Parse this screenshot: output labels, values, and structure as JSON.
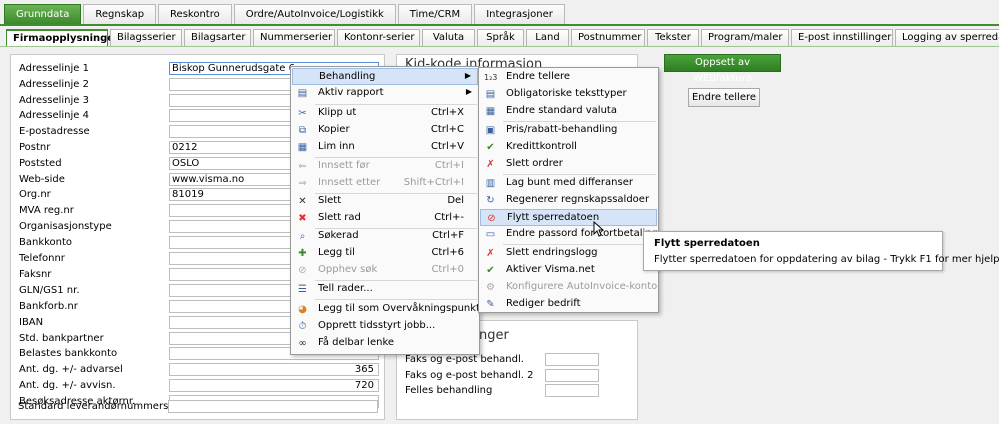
{
  "top_tabs": [
    "Grunndata",
    "Regnskap",
    "Reskontro",
    "Ordre/AutoInvoice/Logistikk",
    "Time/CRM",
    "Integrasjoner"
  ],
  "sub_tabs": [
    "Firmaopplysninger",
    "Bilagsserier",
    "Bilagsarter",
    "Nummerserier",
    "Kontonr-serier",
    "Valuta",
    "Språk",
    "Land",
    "Postnummer",
    "Tekster",
    "Program/maler",
    "E-post innstillinger",
    "Logging av sperredato"
  ],
  "form": [
    {
      "label": "Adresselinje 1",
      "value": "Biskop Gunnerudsgate 6"
    },
    {
      "label": "Adresselinje 2",
      "value": ""
    },
    {
      "label": "Adresselinje 3",
      "value": ""
    },
    {
      "label": "Adresselinje 4",
      "value": ""
    },
    {
      "label": "E-postadresse",
      "value": ""
    },
    {
      "label": "Postnr",
      "value": "0212"
    },
    {
      "label": "Poststed",
      "value": "OSLO"
    },
    {
      "label": "Web-side",
      "value": "www.visma.no"
    },
    {
      "label": "Org.nr",
      "value": "81019"
    },
    {
      "label": "MVA reg.nr",
      "value": ""
    },
    {
      "label": "Organisasjonstype",
      "value": ""
    },
    {
      "label": "Bankkonto",
      "value": ""
    },
    {
      "label": "Telefonnr",
      "value": ""
    },
    {
      "label": "Faksnr",
      "value": ""
    },
    {
      "label": "GLN/GS1 nr.",
      "value": ""
    },
    {
      "label": "Bankforb.nr",
      "value": ""
    },
    {
      "label": "IBAN",
      "value": ""
    },
    {
      "label": "Std. bankpartner",
      "value": ""
    },
    {
      "label": "Belastes bankkonto",
      "value": ""
    },
    {
      "label": "Ant. dg. +/- advarsel",
      "value": "365"
    },
    {
      "label": "Ant. dg. +/- avvisn.",
      "value": "720"
    },
    {
      "label": "Besøksadresse aktørnr.",
      "value": ""
    },
    {
      "label": "Standard leverandørnummerserie",
      "value": ""
    }
  ],
  "mid_title": "Kid-kode informasjon",
  "mid2_title_fragment": "nger",
  "mid2_rows": [
    "Faks og e-post behandl.",
    "Faks og e-post behandl. 2",
    "Felles behandling"
  ],
  "buttons": {
    "webfaktura": "Oppsett av WEBfaktura",
    "endre_tellere": "Endre tellere"
  },
  "menu1": [
    {
      "icon": "",
      "label": "Behandling",
      "shortcut": "",
      "submenu": true,
      "disabled": false
    },
    {
      "icon": "▤",
      "label": "Aktiv rapport",
      "shortcut": "",
      "submenu": true,
      "disabled": false
    },
    {
      "icon": "✂",
      "label": "Klipp ut",
      "shortcut": "Ctrl+X",
      "submenu": false,
      "disabled": false
    },
    {
      "icon": "⧉",
      "label": "Kopier",
      "shortcut": "Ctrl+C",
      "submenu": false,
      "disabled": false
    },
    {
      "icon": "📋",
      "label": "Lim inn",
      "shortcut": "Ctrl+V",
      "submenu": false,
      "disabled": false
    },
    {
      "icon": "⇐",
      "label": "Innsett før",
      "shortcut": "Ctrl+I",
      "submenu": false,
      "disabled": true
    },
    {
      "icon": "⇒",
      "label": "Innsett etter",
      "shortcut": "Shift+Ctrl+I",
      "submenu": false,
      "disabled": true
    },
    {
      "icon": "✕",
      "label": "Slett",
      "shortcut": "Del",
      "submenu": false,
      "disabled": false
    },
    {
      "icon": "✖",
      "label": "Slett rad",
      "shortcut": "Ctrl+-",
      "submenu": false,
      "disabled": false
    },
    {
      "icon": "🔍",
      "label": "Søkerad",
      "shortcut": "Ctrl+F",
      "submenu": false,
      "disabled": false
    },
    {
      "icon": "✚",
      "label": "Legg til",
      "shortcut": "Ctrl+6",
      "submenu": false,
      "disabled": false
    },
    {
      "icon": "⊘",
      "label": "Opphev søk",
      "shortcut": "Ctrl+0",
      "submenu": false,
      "disabled": true
    },
    {
      "icon": "☰",
      "label": "Tell rader...",
      "shortcut": "",
      "submenu": false,
      "disabled": false
    },
    {
      "icon": "◕",
      "label": "Legg til som Overvåkningspunkt...",
      "shortcut": "",
      "submenu": false,
      "disabled": false
    },
    {
      "icon": "⏱",
      "label": "Opprett tidsstyrt jobb...",
      "shortcut": "",
      "submenu": false,
      "disabled": false
    },
    {
      "icon": "∞",
      "label": "Få delbar lenke",
      "shortcut": "",
      "submenu": false,
      "disabled": false
    }
  ],
  "menu2": [
    {
      "icon": "1₂3",
      "label": "Endre tellere",
      "disabled": false
    },
    {
      "icon": "▤",
      "label": "Obligatoriske teksttyper",
      "disabled": false
    },
    {
      "icon": "▦",
      "label": "Endre standard valuta",
      "disabled": false
    },
    {
      "icon": "▣",
      "label": "Pris/rabatt-behandling",
      "disabled": false
    },
    {
      "icon": "✔",
      "label": "Kredittkontroll",
      "disabled": false
    },
    {
      "icon": "✗",
      "label": "Slett ordrer",
      "disabled": false
    },
    {
      "icon": "▥",
      "label": "Lag bunt med differanser",
      "disabled": false
    },
    {
      "icon": "↻",
      "label": "Regenerer regnskapssaldoer",
      "disabled": false
    },
    {
      "icon": "⊘",
      "label": "Flytt sperredatoen",
      "disabled": false
    },
    {
      "icon": "▭",
      "label": "Endre passord for kortbetaling",
      "disabled": false
    },
    {
      "icon": "✗",
      "label": "Slett endringslogg",
      "disabled": false
    },
    {
      "icon": "✔",
      "label": "Aktiver Visma.net",
      "disabled": false
    },
    {
      "icon": "⚙",
      "label": "Konfigurere AutoInvoice-konto",
      "disabled": true
    },
    {
      "icon": "✎",
      "label": "Rediger bedrift",
      "disabled": false
    }
  ],
  "tooltip": {
    "title": "Flytt sperredatoen",
    "body": "Flytter sperredatoen for oppdatering av bilag - Trykk F1 for mer hjelp"
  }
}
